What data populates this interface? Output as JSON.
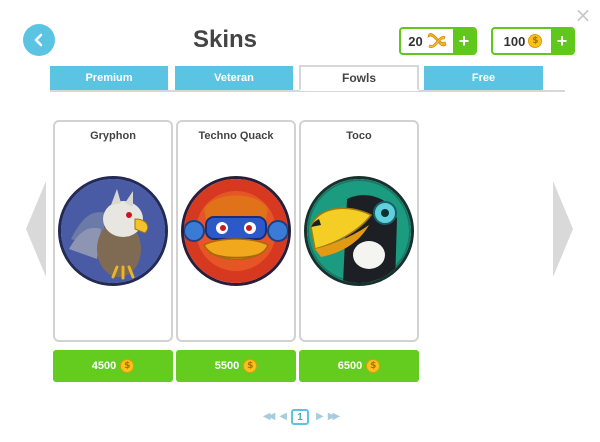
{
  "header": {
    "title": "Skins",
    "ribbons": {
      "amount": "20",
      "icon": "ribbon-icon",
      "plus_label": "+"
    },
    "coins": {
      "amount": "100",
      "icon": "coin-icon",
      "plus_label": "+"
    },
    "coin_symbol": "$"
  },
  "tabs": [
    {
      "label": "Premium",
      "active": false
    },
    {
      "label": "Veteran",
      "active": false
    },
    {
      "label": "Fowls",
      "active": true
    },
    {
      "label": "Free",
      "active": false
    }
  ],
  "skins": [
    {
      "name": "Gryphon",
      "price": "4500",
      "icon": "gryphon-portrait"
    },
    {
      "name": "Techno Quack",
      "price": "5500",
      "icon": "techno-quack-portrait"
    },
    {
      "name": "Toco",
      "price": "6500",
      "icon": "toco-portrait"
    }
  ],
  "pagination": {
    "current_page": "1"
  },
  "colors": {
    "accent_blue": "#5bc4e3",
    "buy_green": "#63cc1f",
    "currency_green": "#5fc81a",
    "coin_gold": "#f6c21c"
  }
}
